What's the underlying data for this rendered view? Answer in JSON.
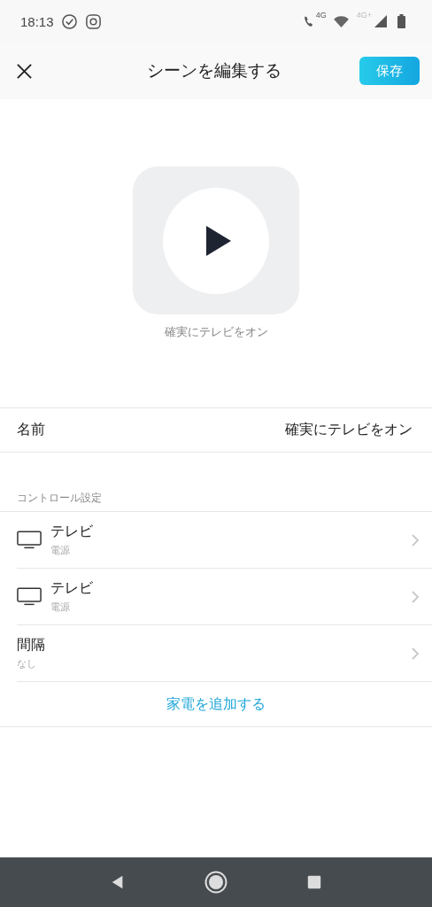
{
  "status_bar": {
    "time": "18:13",
    "call_network": "4G",
    "network": "4G+"
  },
  "header": {
    "title": "シーンを編集する",
    "save_button": "保存"
  },
  "scene": {
    "caption": "確実にテレビをオン"
  },
  "name_row": {
    "label": "名前",
    "value": "確実にテレビをオン"
  },
  "controls": {
    "heading": "コントロール設定",
    "items": [
      {
        "kind": "device",
        "title": "テレビ",
        "subtitle": "電源"
      },
      {
        "kind": "device",
        "title": "テレビ",
        "subtitle": "電源"
      },
      {
        "kind": "interval",
        "title": "間隔",
        "subtitle": "なし"
      }
    ],
    "add_link": "家電を追加する"
  }
}
